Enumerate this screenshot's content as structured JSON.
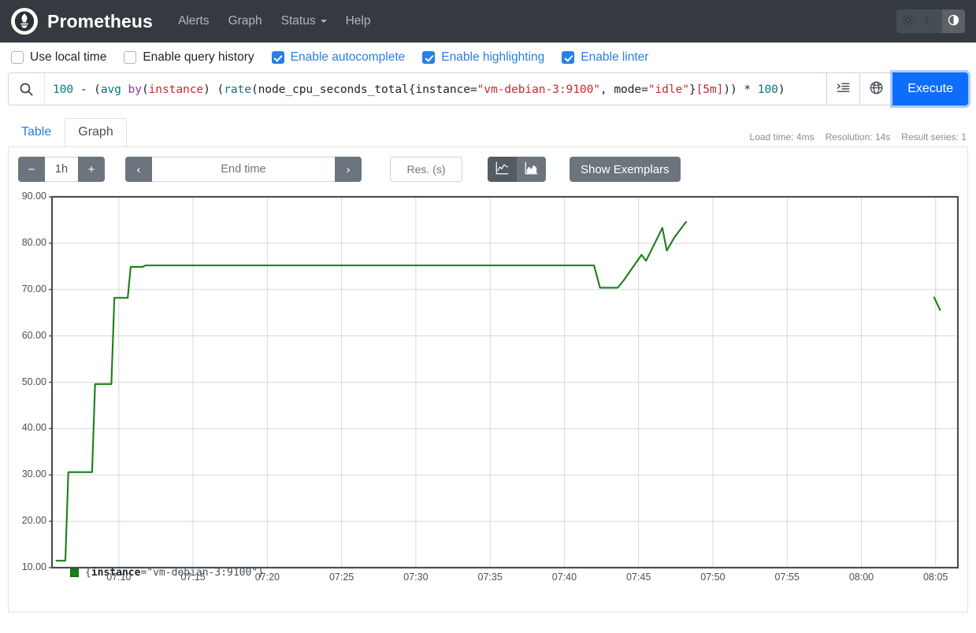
{
  "navbar": {
    "brand": "Prometheus",
    "logo_icon": "prometheus-torch-icon",
    "links": [
      {
        "label": "Alerts",
        "name": "nav-alerts"
      },
      {
        "label": "Graph",
        "name": "nav-graph"
      },
      {
        "label": "Status",
        "name": "nav-status",
        "has_caret": true
      },
      {
        "label": "Help",
        "name": "nav-help"
      }
    ],
    "theme_buttons": [
      {
        "icon": "sun-icon",
        "label": "Light theme",
        "active": false
      },
      {
        "icon": "moon-icon",
        "label": "Dark theme",
        "active": false
      },
      {
        "icon": "contrast-icon",
        "label": "Auto theme",
        "active": true
      }
    ]
  },
  "settings": {
    "options": [
      {
        "label": "Use local time",
        "checked": false,
        "name": "use-local-time"
      },
      {
        "label": "Enable query history",
        "checked": false,
        "name": "enable-query-history"
      },
      {
        "label": "Enable autocomplete",
        "checked": true,
        "name": "enable-autocomplete"
      },
      {
        "label": "Enable highlighting",
        "checked": true,
        "name": "enable-highlighting"
      },
      {
        "label": "Enable linter",
        "checked": true,
        "name": "enable-linter"
      }
    ]
  },
  "query": {
    "expression": "100 - (avg by(instance) (rate(node_cpu_seconds_total{instance=\"vm-debian-3:9100\", mode=\"idle\"}[5m])) * 100)",
    "search_icon": "search-icon",
    "metrics_explorer_icon": "metrics-explorer-icon",
    "globe_icon": "globe-icon",
    "execute_label": "Execute"
  },
  "tabs": [
    {
      "label": "Table",
      "active": false,
      "name": "tab-table"
    },
    {
      "label": "Graph",
      "active": true,
      "name": "tab-graph"
    }
  ],
  "stats": {
    "load_time": "Load time: 4ms",
    "resolution": "Resolution: 14s",
    "result_series": "Result series: 1"
  },
  "graph_controls": {
    "decrease_label": "−",
    "range_value": "1h",
    "increase_label": "+",
    "prev_label": "‹",
    "end_time_placeholder": "End time",
    "end_time_value": "",
    "next_label": "›",
    "resolution_placeholder": "Res. (s)",
    "resolution_value": "",
    "line_chart_icon": "line-chart-icon",
    "stacked_chart_icon": "stacked-area-chart-icon",
    "chart_type_selected": "line",
    "exemplars_label": "Show Exemplars"
  },
  "legend": [
    {
      "color": "#1a7f1a",
      "label_key": "instance",
      "label_text": "{instance=\"vm-debian-3:9100\"}"
    }
  ],
  "chart_data": {
    "type": "line",
    "title": "",
    "xlabel": "",
    "ylabel": "",
    "ylim": [
      10,
      90
    ],
    "ytick_labels": [
      "90.00",
      "80.00",
      "70.00",
      "60.00",
      "50.00",
      "40.00",
      "30.00",
      "20.00",
      "10.00"
    ],
    "ytick_values": [
      90,
      80,
      70,
      60,
      50,
      40,
      30,
      20,
      10
    ],
    "xtick_labels": [
      "07:10",
      "07:15",
      "07:20",
      "07:25",
      "07:30",
      "07:35",
      "07:40",
      "07:45",
      "07:50",
      "07:55",
      "08:00",
      "08:05"
    ],
    "xlim_minutes": [
      425.5,
      486.5
    ],
    "grid": true,
    "legend_position": "bottom-left",
    "line_color": "#1a7f1a",
    "series": [
      {
        "name": "{instance=\"vm-debian-3:9100\"}",
        "points_minutes_value": [
          [
            425.8,
            11.5
          ],
          [
            426.4,
            11.5
          ],
          [
            426.6,
            30.6
          ],
          [
            428.2,
            30.6
          ],
          [
            428.4,
            49.6
          ],
          [
            429.5,
            49.6
          ],
          [
            429.7,
            68.2
          ],
          [
            430.6,
            68.2
          ],
          [
            430.8,
            74.9
          ],
          [
            431.6,
            74.9
          ],
          [
            431.8,
            75.2
          ],
          [
            462.0,
            75.2
          ],
          [
            462.4,
            70.4
          ],
          [
            463.6,
            70.4
          ],
          [
            464.0,
            72.0
          ],
          [
            465.2,
            77.5
          ],
          [
            465.5,
            76.2
          ],
          [
            466.0,
            79.4
          ],
          [
            466.6,
            83.3
          ],
          [
            466.9,
            78.4
          ],
          [
            467.4,
            81.2
          ],
          [
            468.2,
            84.6
          ]
        ],
        "tail_segment_minutes_value": [
          [
            484.9,
            68.3
          ],
          [
            485.3,
            65.6
          ]
        ]
      }
    ]
  }
}
